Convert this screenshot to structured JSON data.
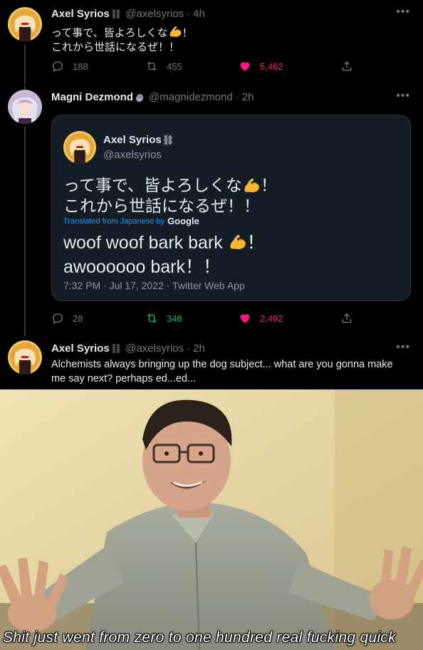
{
  "tweets": [
    {
      "name": "Axel Syrios",
      "badge": "⛓",
      "handle": "@axelsyrios",
      "dot": "·",
      "time": "4h",
      "line1": "って事で、皆よろしくな",
      "line1_end": "！",
      "line2": "これから世話になるぜ！！",
      "reply_count": "188",
      "retweet_count": "455",
      "like_count": "5,462"
    },
    {
      "name": "Magni Dezmond",
      "handle": "@magnidezmond",
      "dot": "·",
      "time": "2h",
      "reply_count": "28",
      "retweet_count": "348",
      "like_count": "2,492",
      "quote": {
        "name": "Axel Syrios",
        "badge": "⛓",
        "handle": "@axelsyrios",
        "line1": "って事で、皆よろしくな",
        "line1_end": "！",
        "line2": "これから世話になるぜ！！",
        "translated_from": "Translated from Japanese by",
        "translator": "Google",
        "translated_line1": "woof woof bark bark",
        "translated_line1_end": "！",
        "translated_line2": "awoooooo bark！！",
        "meta": "7:32 PM · Jul 17, 2022 · Twitter Web App"
      }
    },
    {
      "name": "Axel Syrios",
      "badge": "⛓",
      "handle": "@axelsyrios",
      "dot": "·",
      "time": "2h",
      "line1": "Alchemists always bringing up the dog subject... what are you gonna make",
      "line2": "me say next? perhaps ed...ed..."
    }
  ],
  "meme": {
    "caption": "Shit just went from zero to one hundred real fucking quick"
  },
  "icons": [
    "reply-icon",
    "retweet-icon",
    "like-icon",
    "share-icon",
    "more-icon",
    "flexed-biceps-emoji"
  ],
  "colors": {
    "like": "#f91880",
    "retweet": "#00ba7c",
    "link": "#1d9bf0",
    "muted": "#71767b"
  }
}
